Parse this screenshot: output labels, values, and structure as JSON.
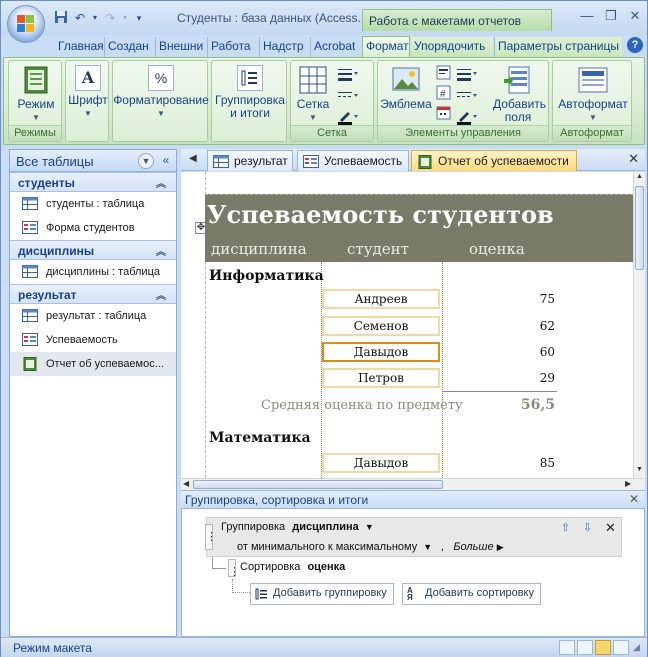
{
  "window": {
    "title": "Студенты : база данных (Access... М...",
    "context_tab_title": "Работа с макетами отчетов",
    "controls": [
      "—",
      "❐",
      "✕"
    ]
  },
  "ribbon_tabs": [
    {
      "label": "Главная"
    },
    {
      "label": "Создан"
    },
    {
      "label": "Внешни"
    },
    {
      "label": "Работа"
    },
    {
      "label": "Надстр"
    },
    {
      "label": "Acrobat"
    },
    {
      "label": "Формат"
    },
    {
      "label": "Упорядочить"
    },
    {
      "label": "Параметры страницы"
    }
  ],
  "help_label": "?",
  "ribbon": {
    "groups": [
      {
        "label": "Режимы",
        "buttons": [
          "Режим"
        ]
      },
      {
        "label": "",
        "buttons": [
          "Шрифт"
        ]
      },
      {
        "label": "",
        "buttons": [
          "Форматирование"
        ]
      },
      {
        "label": "",
        "buttons": [
          "Группировка и итоги"
        ]
      },
      {
        "label": "Сетка",
        "buttons": [
          "Сетка"
        ]
      },
      {
        "label": "Элементы управления",
        "buttons": [
          "Эмблема",
          "Добавить поля"
        ]
      },
      {
        "label": "Автоформат",
        "buttons": [
          "Автоформат"
        ]
      }
    ]
  },
  "nav": {
    "title": "Все таблицы",
    "groups": [
      {
        "name": "студенты",
        "items": [
          {
            "label": "студенты : таблица",
            "icon": "table-icon"
          },
          {
            "label": "Форма студентов",
            "icon": "form-icon"
          }
        ]
      },
      {
        "name": "дисциплины",
        "items": [
          {
            "label": "дисциплины : таблица",
            "icon": "table-icon"
          }
        ]
      },
      {
        "name": "результат",
        "items": [
          {
            "label": "результат : таблица",
            "icon": "table-icon"
          },
          {
            "label": "Успеваемость",
            "icon": "form-icon"
          },
          {
            "label": "Отчет об успеваемос...",
            "icon": "report-icon"
          }
        ]
      }
    ]
  },
  "doc_tabs": [
    {
      "label": "результат"
    },
    {
      "label": "Успеваемость"
    },
    {
      "label": "Отчет об успеваемости"
    }
  ],
  "report": {
    "title": "Успеваемость студентов",
    "columns": [
      "дисциплина",
      "студент",
      "оценка"
    ],
    "groups": [
      {
        "name": "Информатика",
        "rows": [
          {
            "student": "Андреев",
            "score": "75"
          },
          {
            "student": "Семенов",
            "score": "62"
          },
          {
            "student": "Давыдов",
            "score": "60"
          },
          {
            "student": "Петров",
            "score": "29"
          }
        ],
        "avg_label": "Средняя оценка по предмету",
        "avg_value": "56,5"
      },
      {
        "name": "Математика",
        "rows": [
          {
            "student": "Давыдов",
            "score": "85"
          }
        ]
      }
    ]
  },
  "group_pane": {
    "title": "Группировка, сортировка и итоги",
    "grouping_label": "Группировка",
    "grouping_field": "дисциплина",
    "order": "от минимального к максимальному",
    "more": "Больше",
    "sorting_label": "Сортировка",
    "sorting_field": "оценка",
    "add_group": "Добавить группировку",
    "add_sort": "Добавить сортировку"
  },
  "status": {
    "text": "Режим макета"
  }
}
